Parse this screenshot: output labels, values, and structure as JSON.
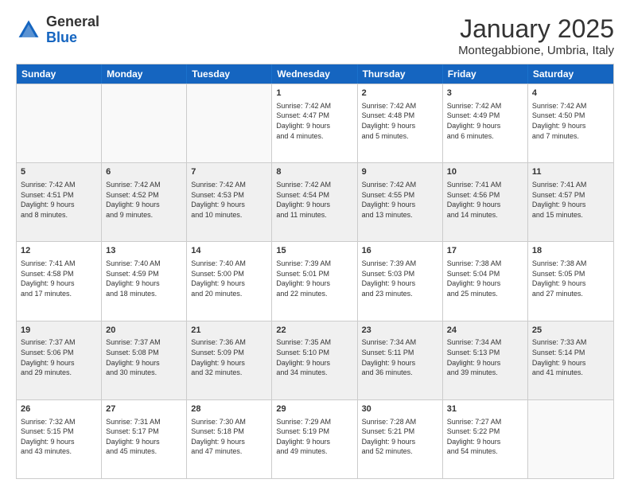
{
  "header": {
    "logo_general": "General",
    "logo_blue": "Blue",
    "month_title": "January 2025",
    "subtitle": "Montegabbione, Umbria, Italy"
  },
  "days_of_week": [
    "Sunday",
    "Monday",
    "Tuesday",
    "Wednesday",
    "Thursday",
    "Friday",
    "Saturday"
  ],
  "weeks": [
    [
      {
        "day": "",
        "info": "",
        "empty": true
      },
      {
        "day": "",
        "info": "",
        "empty": true
      },
      {
        "day": "",
        "info": "",
        "empty": true
      },
      {
        "day": "1",
        "info": "Sunrise: 7:42 AM\nSunset: 4:47 PM\nDaylight: 9 hours\nand 4 minutes."
      },
      {
        "day": "2",
        "info": "Sunrise: 7:42 AM\nSunset: 4:48 PM\nDaylight: 9 hours\nand 5 minutes."
      },
      {
        "day": "3",
        "info": "Sunrise: 7:42 AM\nSunset: 4:49 PM\nDaylight: 9 hours\nand 6 minutes."
      },
      {
        "day": "4",
        "info": "Sunrise: 7:42 AM\nSunset: 4:50 PM\nDaylight: 9 hours\nand 7 minutes."
      }
    ],
    [
      {
        "day": "5",
        "info": "Sunrise: 7:42 AM\nSunset: 4:51 PM\nDaylight: 9 hours\nand 8 minutes."
      },
      {
        "day": "6",
        "info": "Sunrise: 7:42 AM\nSunset: 4:52 PM\nDaylight: 9 hours\nand 9 minutes."
      },
      {
        "day": "7",
        "info": "Sunrise: 7:42 AM\nSunset: 4:53 PM\nDaylight: 9 hours\nand 10 minutes."
      },
      {
        "day": "8",
        "info": "Sunrise: 7:42 AM\nSunset: 4:54 PM\nDaylight: 9 hours\nand 11 minutes."
      },
      {
        "day": "9",
        "info": "Sunrise: 7:42 AM\nSunset: 4:55 PM\nDaylight: 9 hours\nand 13 minutes."
      },
      {
        "day": "10",
        "info": "Sunrise: 7:41 AM\nSunset: 4:56 PM\nDaylight: 9 hours\nand 14 minutes."
      },
      {
        "day": "11",
        "info": "Sunrise: 7:41 AM\nSunset: 4:57 PM\nDaylight: 9 hours\nand 15 minutes."
      }
    ],
    [
      {
        "day": "12",
        "info": "Sunrise: 7:41 AM\nSunset: 4:58 PM\nDaylight: 9 hours\nand 17 minutes."
      },
      {
        "day": "13",
        "info": "Sunrise: 7:40 AM\nSunset: 4:59 PM\nDaylight: 9 hours\nand 18 minutes."
      },
      {
        "day": "14",
        "info": "Sunrise: 7:40 AM\nSunset: 5:00 PM\nDaylight: 9 hours\nand 20 minutes."
      },
      {
        "day": "15",
        "info": "Sunrise: 7:39 AM\nSunset: 5:01 PM\nDaylight: 9 hours\nand 22 minutes."
      },
      {
        "day": "16",
        "info": "Sunrise: 7:39 AM\nSunset: 5:03 PM\nDaylight: 9 hours\nand 23 minutes."
      },
      {
        "day": "17",
        "info": "Sunrise: 7:38 AM\nSunset: 5:04 PM\nDaylight: 9 hours\nand 25 minutes."
      },
      {
        "day": "18",
        "info": "Sunrise: 7:38 AM\nSunset: 5:05 PM\nDaylight: 9 hours\nand 27 minutes."
      }
    ],
    [
      {
        "day": "19",
        "info": "Sunrise: 7:37 AM\nSunset: 5:06 PM\nDaylight: 9 hours\nand 29 minutes."
      },
      {
        "day": "20",
        "info": "Sunrise: 7:37 AM\nSunset: 5:08 PM\nDaylight: 9 hours\nand 30 minutes."
      },
      {
        "day": "21",
        "info": "Sunrise: 7:36 AM\nSunset: 5:09 PM\nDaylight: 9 hours\nand 32 minutes."
      },
      {
        "day": "22",
        "info": "Sunrise: 7:35 AM\nSunset: 5:10 PM\nDaylight: 9 hours\nand 34 minutes."
      },
      {
        "day": "23",
        "info": "Sunrise: 7:34 AM\nSunset: 5:11 PM\nDaylight: 9 hours\nand 36 minutes."
      },
      {
        "day": "24",
        "info": "Sunrise: 7:34 AM\nSunset: 5:13 PM\nDaylight: 9 hours\nand 39 minutes."
      },
      {
        "day": "25",
        "info": "Sunrise: 7:33 AM\nSunset: 5:14 PM\nDaylight: 9 hours\nand 41 minutes."
      }
    ],
    [
      {
        "day": "26",
        "info": "Sunrise: 7:32 AM\nSunset: 5:15 PM\nDaylight: 9 hours\nand 43 minutes."
      },
      {
        "day": "27",
        "info": "Sunrise: 7:31 AM\nSunset: 5:17 PM\nDaylight: 9 hours\nand 45 minutes."
      },
      {
        "day": "28",
        "info": "Sunrise: 7:30 AM\nSunset: 5:18 PM\nDaylight: 9 hours\nand 47 minutes."
      },
      {
        "day": "29",
        "info": "Sunrise: 7:29 AM\nSunset: 5:19 PM\nDaylight: 9 hours\nand 49 minutes."
      },
      {
        "day": "30",
        "info": "Sunrise: 7:28 AM\nSunset: 5:21 PM\nDaylight: 9 hours\nand 52 minutes."
      },
      {
        "day": "31",
        "info": "Sunrise: 7:27 AM\nSunset: 5:22 PM\nDaylight: 9 hours\nand 54 minutes."
      },
      {
        "day": "",
        "info": "",
        "empty": true
      }
    ]
  ]
}
